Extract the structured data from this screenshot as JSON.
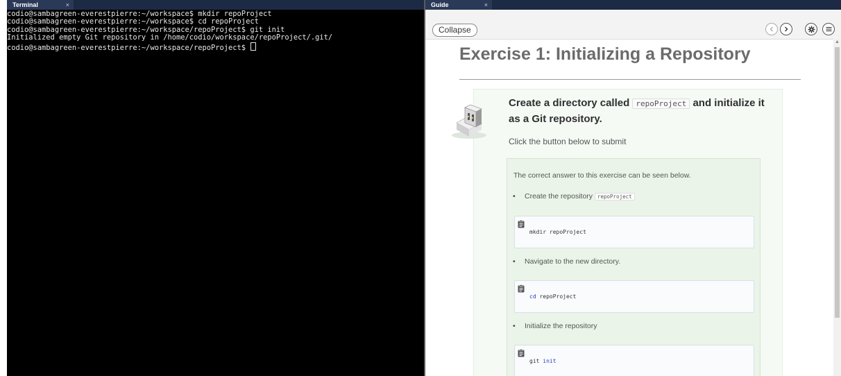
{
  "terminal": {
    "tab_label": "Terminal",
    "tab_close": "×",
    "lines": [
      "codio@sambagreen-everestpierre:~/workspace$ mkdir repoProject",
      "codio@sambagreen-everestpierre:~/workspace$ cd repoProject",
      "codio@sambagreen-everestpierre:~/workspace/repoProject$ git init",
      "Initialized empty Git repository in /home/codio/workspace/repoProject/.git/",
      "codio@sambagreen-everestpierre:~/workspace/repoProject$ "
    ]
  },
  "guide": {
    "tab_label": "Guide",
    "tab_close": "×",
    "collapse_label": "Collapse",
    "toolbar_icons": [
      "chevron-left-icon",
      "chevron-right-icon",
      "gear-icon",
      "menu-list-icon"
    ],
    "title": "Exercise 1: Initializing a Repository",
    "question_before": "Create a directory called ",
    "question_code": "repoProject",
    "question_after": " and initialize it as a Git repository.",
    "submit_hint": "Click the button below to submit",
    "answer_intro": "The correct answer to this exercise can be seen below.",
    "steps": [
      {
        "text": "Create the repository ",
        "code_inline": "repoProject",
        "command": "mkdir repoProject",
        "cmd_kw": "",
        "cmd_rest": "mkdir repoProject",
        "cmd_tail": ""
      },
      {
        "text": "Navigate to the new directory.",
        "code_inline": "",
        "command": "cd repoProject",
        "cmd_kw": "cd",
        "cmd_rest": " repoProject",
        "cmd_tail": ""
      },
      {
        "text": "Initialize the repository",
        "code_inline": "",
        "command": "git init",
        "cmd_kw": "",
        "cmd_rest": "git ",
        "cmd_tail": "init"
      }
    ]
  },
  "colors": {
    "terminal_bg": "#000000",
    "tabbar_bg": "#1d2a44",
    "card_bg": "#f5faf5",
    "answer_bg": "#eaf4e8",
    "keyword": "#2b39b8"
  }
}
